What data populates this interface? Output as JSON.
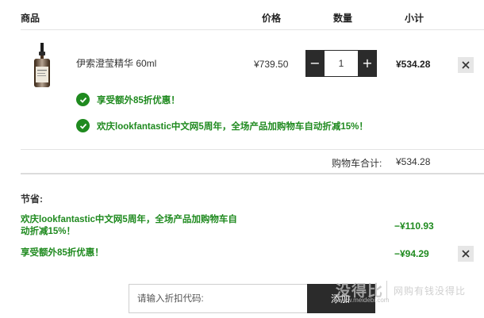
{
  "headers": {
    "product": "商品",
    "price": "价格",
    "quantity": "数量",
    "subtotal": "小计"
  },
  "item": {
    "name": "伊索澄莹精华 60ml",
    "price": "¥739.50",
    "quantity": "1",
    "decrease_label": "−",
    "increase_label": "+",
    "subtotal": "¥534.28"
  },
  "promotions": [
    "享受额外85折优惠！",
    "欢庆lookfantastic中文网5周年，全场产品加购物车自动折减15%！"
  ],
  "cart_total": {
    "label": "购物车合计:",
    "value": "¥534.28"
  },
  "savings": {
    "title": "节省:",
    "items": [
      {
        "desc_line1": "欢庆lookfantastic中文网5周年，全场产品加购物车自",
        "desc_line2": "动折减15%！",
        "amount": "−¥110.93"
      },
      {
        "desc_line1": "享受额外85折优惠！",
        "amount": "−¥94.29"
      }
    ]
  },
  "discount": {
    "placeholder": "请输入折扣代码:",
    "apply_label": "添加"
  },
  "watermark": {
    "logo": "没得比",
    "sub": "www.meidebi.com",
    "slogan": "网购有钱没得比"
  },
  "icons": {
    "remove": "close-icon",
    "promo": "check-circle-icon",
    "product": "serum-bottle-image"
  },
  "colors": {
    "promo_green": "#1f8a1f",
    "button_dark": "#2b2b2b",
    "remove_bg": "#e6e6e6"
  }
}
